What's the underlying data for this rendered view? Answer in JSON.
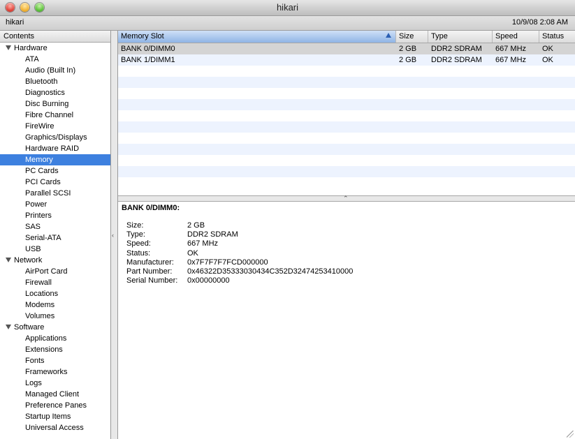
{
  "window": {
    "title": "hikari"
  },
  "infobar": {
    "hostname": "hikari",
    "datetime": "10/9/08 2:08 AM"
  },
  "sidebar": {
    "header": "Contents",
    "items": [
      {
        "label": "Hardware",
        "group": true
      },
      {
        "label": "ATA"
      },
      {
        "label": "Audio (Built In)"
      },
      {
        "label": "Bluetooth"
      },
      {
        "label": "Diagnostics"
      },
      {
        "label": "Disc Burning"
      },
      {
        "label": "Fibre Channel"
      },
      {
        "label": "FireWire"
      },
      {
        "label": "Graphics/Displays"
      },
      {
        "label": "Hardware RAID"
      },
      {
        "label": "Memory",
        "selected": true
      },
      {
        "label": "PC Cards"
      },
      {
        "label": "PCI Cards"
      },
      {
        "label": "Parallel SCSI"
      },
      {
        "label": "Power"
      },
      {
        "label": "Printers"
      },
      {
        "label": "SAS"
      },
      {
        "label": "Serial-ATA"
      },
      {
        "label": "USB"
      },
      {
        "label": "Network",
        "group": true
      },
      {
        "label": "AirPort Card"
      },
      {
        "label": "Firewall"
      },
      {
        "label": "Locations"
      },
      {
        "label": "Modems"
      },
      {
        "label": "Volumes"
      },
      {
        "label": "Software",
        "group": true
      },
      {
        "label": "Applications"
      },
      {
        "label": "Extensions"
      },
      {
        "label": "Fonts"
      },
      {
        "label": "Frameworks"
      },
      {
        "label": "Logs"
      },
      {
        "label": "Managed Client"
      },
      {
        "label": "Preference Panes"
      },
      {
        "label": "Startup Items"
      },
      {
        "label": "Universal Access"
      }
    ]
  },
  "table": {
    "columns": [
      "Memory Slot",
      "Size",
      "Type",
      "Speed",
      "Status"
    ],
    "rows": [
      [
        "BANK 0/DIMM0",
        "2 GB",
        "DDR2 SDRAM",
        "667 MHz",
        "OK"
      ],
      [
        "BANK 1/DIMM1",
        "2 GB",
        "DDR2 SDRAM",
        "667 MHz",
        "OK"
      ]
    ]
  },
  "detail": {
    "title": "BANK 0/DIMM0:",
    "fields": [
      [
        "Size:",
        "2 GB"
      ],
      [
        "Type:",
        "DDR2 SDRAM"
      ],
      [
        "Speed:",
        "667 MHz"
      ],
      [
        "Status:",
        "OK"
      ],
      [
        "Manufacturer:",
        "0x7F7F7F7FCD000000"
      ],
      [
        "Part Number:",
        "0x46322D35333030434C352D32474253410000"
      ],
      [
        "Serial Number:",
        "0x00000000"
      ]
    ]
  },
  "colors": {
    "selection": "#3d80df",
    "row_alt": "#edf3fe"
  }
}
